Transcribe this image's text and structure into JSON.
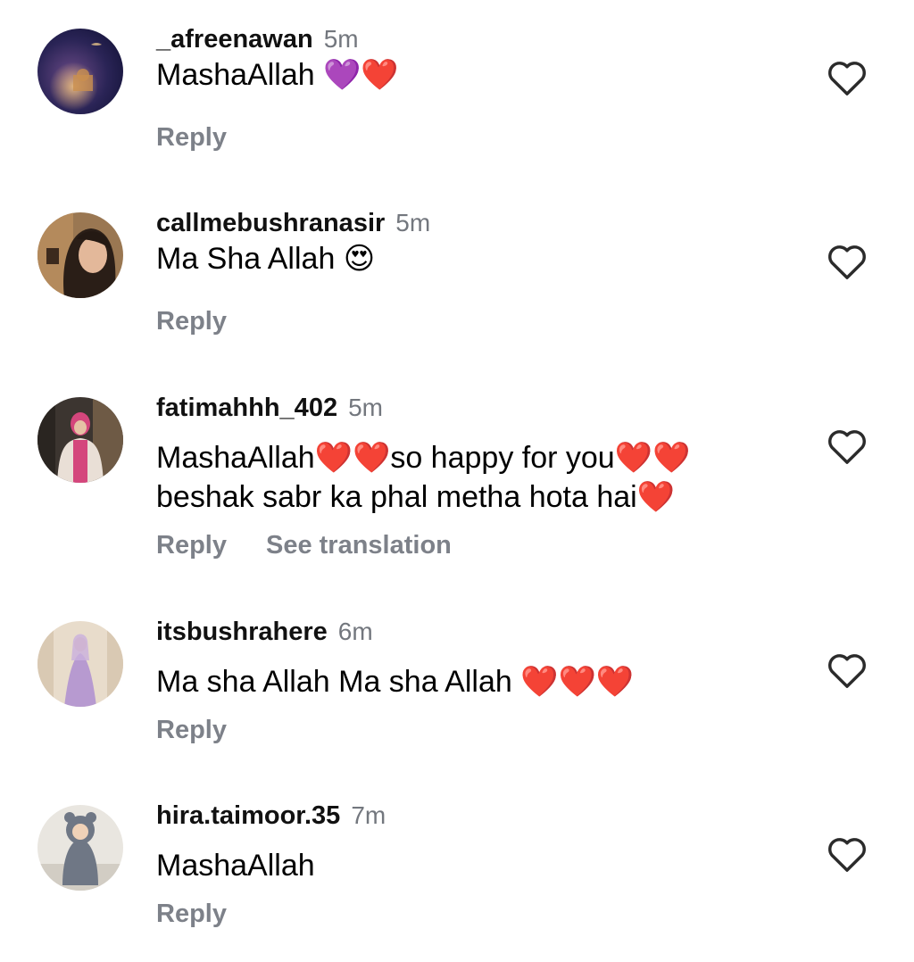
{
  "comments": [
    {
      "username": "_afreenawan",
      "time": "5m",
      "text_lines": [
        "MashaAllah 💜❤️"
      ],
      "reply_label": "Reply",
      "translate_label": "",
      "avatar": "crescent-moon-avatar"
    },
    {
      "username": "callmebushranasir",
      "time": "5m",
      "text_lines": [
        "Ma Sha Allah 😍"
      ],
      "reply_label": "Reply",
      "translate_label": "",
      "avatar": "woman-portrait-avatar"
    },
    {
      "username": "fatimahhh_402",
      "time": "5m",
      "text_lines": [
        "MashaAllah❤️❤️so happy for you❤️❤️",
        "beshak sabr ka phal metha hota hai❤️"
      ],
      "reply_label": "Reply",
      "translate_label": "See translation",
      "avatar": "woman-pink-avatar"
    },
    {
      "username": "itsbushrahere",
      "time": "6m",
      "text_lines": [
        "Ma sha Allah Ma sha Allah ❤️❤️❤️"
      ],
      "reply_label": "Reply",
      "translate_label": "",
      "avatar": "bride-lilac-avatar"
    },
    {
      "username": "hira.taimoor.35",
      "time": "7m",
      "text_lines": [
        "MashaAllah"
      ],
      "reply_label": "Reply",
      "translate_label": "",
      "avatar": "baby-bear-suit-avatar"
    }
  ],
  "icons": {
    "like": "heart-outline-icon"
  },
  "colors": {
    "username": "#111111",
    "timestamp": "#73777e",
    "action": "#7d8189",
    "like_icon": "#2b2b2b"
  }
}
